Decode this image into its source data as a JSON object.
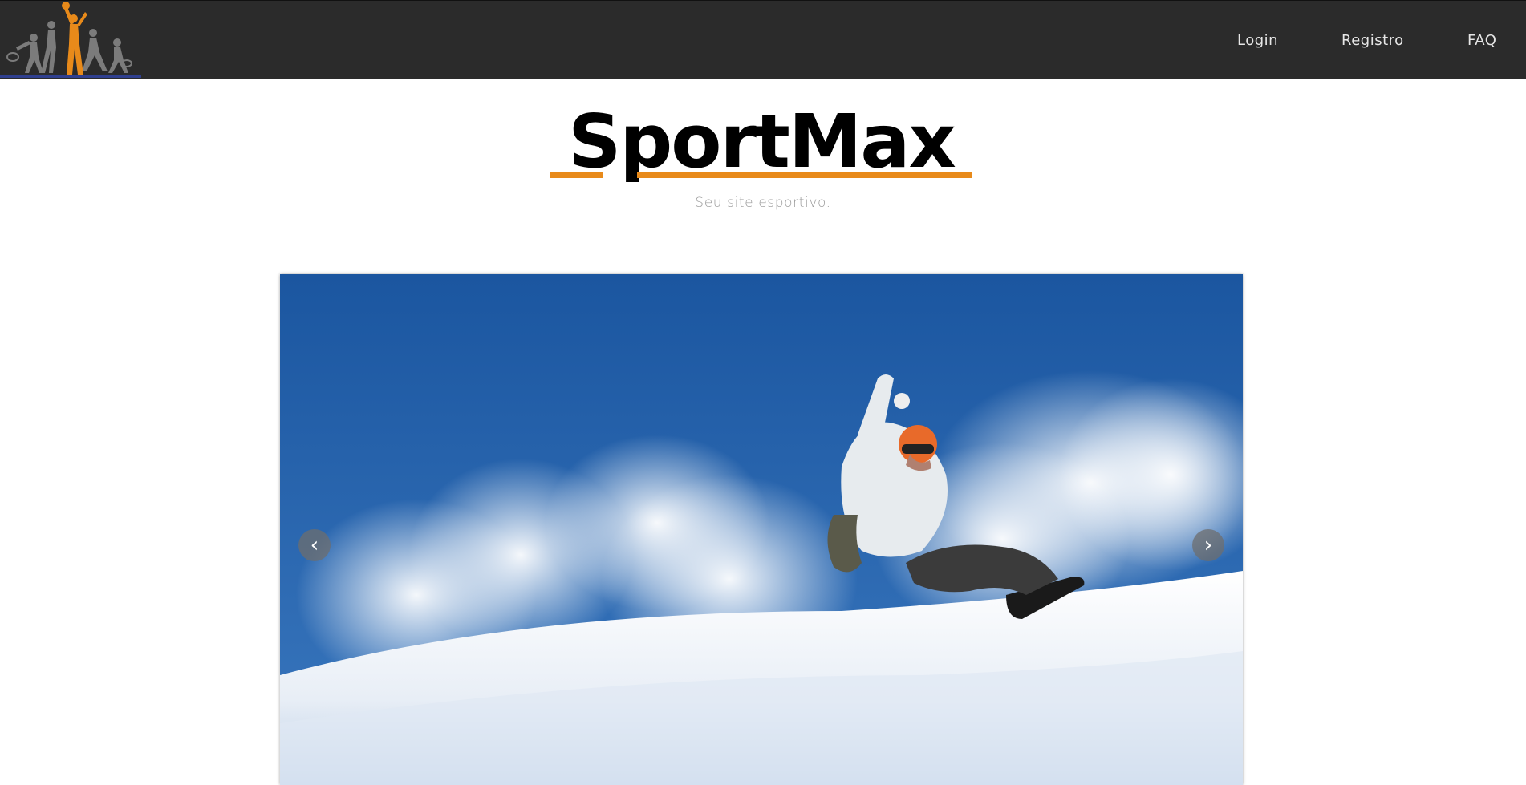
{
  "header": {
    "logo_icon": "athletes-silhouette-logo",
    "nav": [
      {
        "label": "Login"
      },
      {
        "label": "Registro"
      },
      {
        "label": "FAQ"
      }
    ]
  },
  "brand": {
    "name": "SportMax",
    "tagline": "Seu site esportivo.",
    "accent_color": "#e88a1a"
  },
  "carousel": {
    "prev_label": "‹",
    "next_label": "›",
    "slide_image": "snowboarder-in-powder-snow"
  },
  "colors": {
    "topbar": "#2b2b2b",
    "sky": "#1f5aa3",
    "accent": "#e88a1a"
  }
}
